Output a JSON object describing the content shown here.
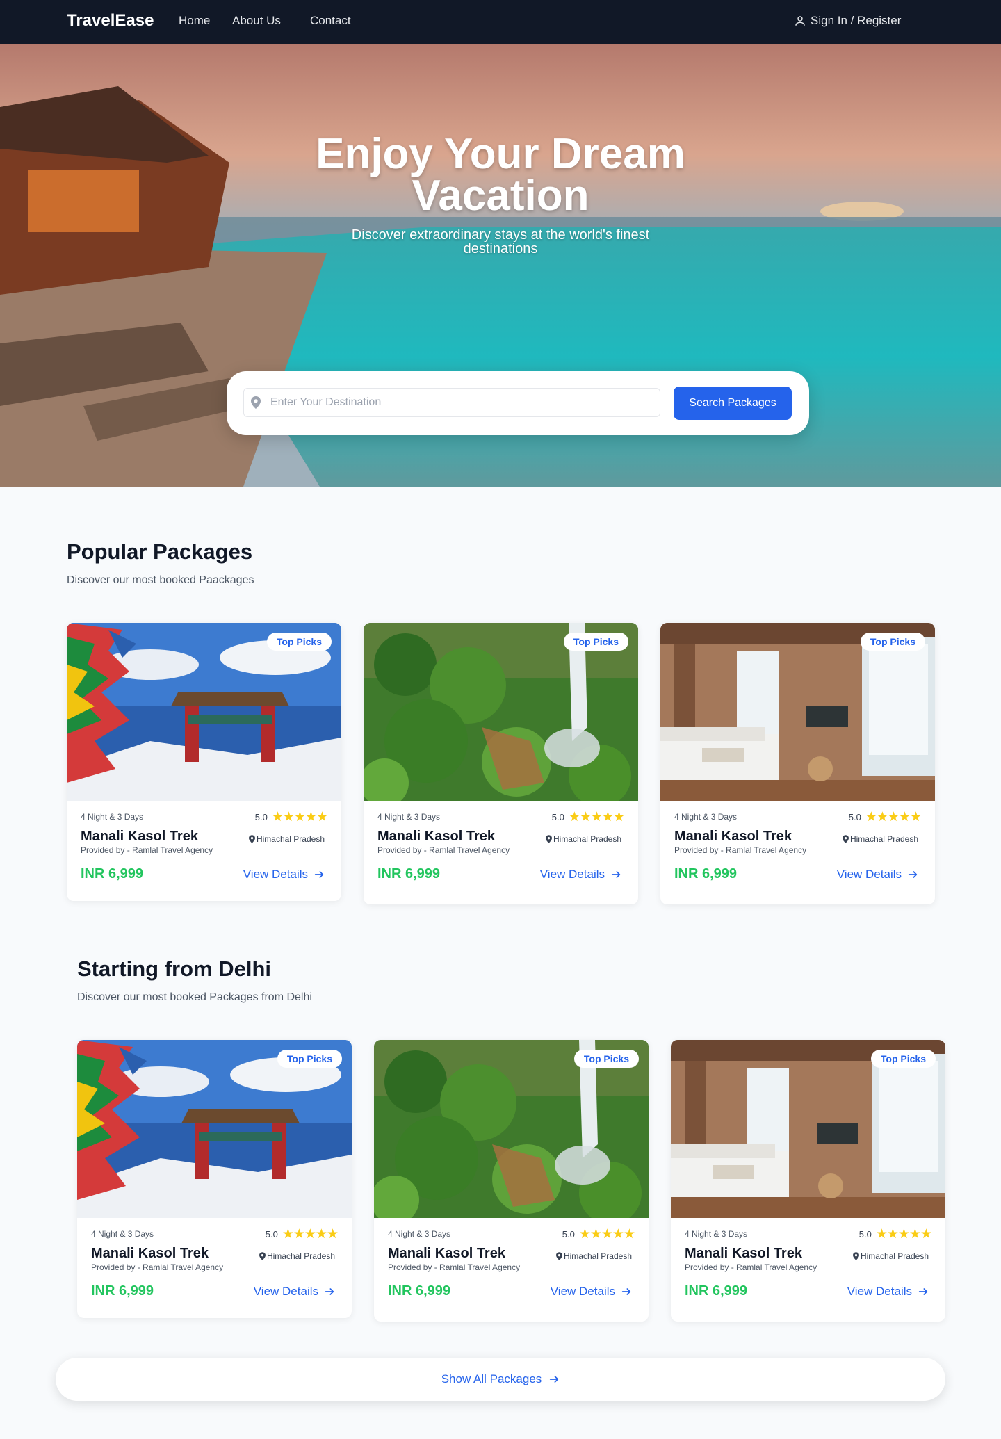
{
  "nav": {
    "logo": "TravelEase",
    "links": [
      "Home",
      "About Us",
      "Contact"
    ],
    "signin": "Sign In / Register"
  },
  "hero": {
    "title_line1": "Enjoy Your Dream",
    "title_line2": "Vacation",
    "subtitle": "Discover extraordinary stays at the world's finest destinations",
    "search_placeholder": "Enter Your Destination",
    "search_button": "Search Packages"
  },
  "popular": {
    "title": "Popular Packages",
    "subtitle": "Discover our most booked Paackages",
    "cards": [
      {
        "badge": "Top Picks",
        "duration": "4 Night & 3 Days",
        "rating": "5.0",
        "stars": "★★★★★",
        "title": "Manali Kasol Trek",
        "location": "Himachal Pradesh",
        "provider": "Provided by - Ramlal Travel Agency",
        "price": "INR 6,999",
        "cta": "View Details",
        "image": "prayer-flags-gate"
      },
      {
        "badge": "Top Picks",
        "duration": "4 Night & 3 Days",
        "rating": "5.0",
        "stars": "★★★★★",
        "title": "Manali Kasol Trek",
        "location": "Himachal Pradesh",
        "provider": "Provided by - Ramlal Travel Agency",
        "price": "INR 6,999",
        "cta": "View Details",
        "image": "waterfall-forest"
      },
      {
        "badge": "Top Picks",
        "duration": "4 Night & 3 Days",
        "rating": "5.0",
        "stars": "★★★★★",
        "title": "Manali Kasol Trek",
        "location": "Himachal Pradesh",
        "provider": "Provided by - Ramlal Travel Agency",
        "price": "INR 6,999",
        "cta": "View Details",
        "image": "hotel-bedroom"
      }
    ]
  },
  "delhi": {
    "title": "Starting from Delhi",
    "subtitle": "Discover our most booked Packages from Delhi",
    "cards": [
      {
        "badge": "Top Picks",
        "duration": "4 Night & 3 Days",
        "rating": "5.0",
        "stars": "★★★★★",
        "title": "Manali Kasol Trek",
        "location": "Himachal Pradesh",
        "provider": "Provided by - Ramlal Travel Agency",
        "price": "INR 6,999",
        "cta": "View Details",
        "image": "prayer-flags-gate"
      },
      {
        "badge": "Top Picks",
        "duration": "4 Night & 3 Days",
        "rating": "5.0",
        "stars": "★★★★★",
        "title": "Manali Kasol Trek",
        "location": "Himachal Pradesh",
        "provider": "Provided by - Ramlal Travel Agency",
        "price": "INR 6,999",
        "cta": "View Details",
        "image": "waterfall-forest"
      },
      {
        "badge": "Top Picks",
        "duration": "4 Night & 3 Days",
        "rating": "5.0",
        "stars": "★★★★★",
        "title": "Manali Kasol Trek",
        "location": "Himachal Pradesh",
        "provider": "Provided by - Ramlal Travel Agency",
        "price": "INR 6,999",
        "cta": "View Details",
        "image": "hotel-bedroom"
      }
    ]
  },
  "show_all": "Show All Packages",
  "colors": {
    "nav_bg": "#111827",
    "accent": "#2563eb",
    "price": "#22c55e",
    "star": "#facc15"
  }
}
